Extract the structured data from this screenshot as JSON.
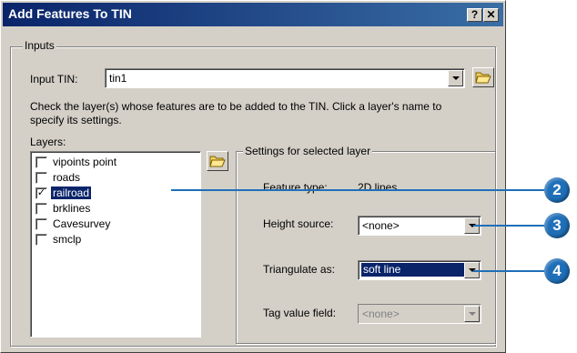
{
  "window": {
    "title": "Add Features To TIN",
    "help_button": "?",
    "close_button": "✕"
  },
  "inputs_group": {
    "legend": "Inputs",
    "input_tin_label": "Input TIN:",
    "input_tin_value": "tin1",
    "instructions": "Check the layer(s) whose features are to be added to the TIN. Click a layer's name to specify its settings.",
    "layers_label": "Layers:",
    "layers": [
      {
        "name": "vipoints point",
        "checked": false,
        "selected": false
      },
      {
        "name": "roads",
        "checked": false,
        "selected": false
      },
      {
        "name": "railroad",
        "checked": true,
        "selected": true
      },
      {
        "name": "brklines",
        "checked": false,
        "selected": false
      },
      {
        "name": "Cavesurvey",
        "checked": false,
        "selected": false
      },
      {
        "name": "smclp",
        "checked": false,
        "selected": false
      }
    ]
  },
  "settings_group": {
    "legend": "Settings for selected layer",
    "feature_type_label": "Feature type:",
    "feature_type_value": "2D lines",
    "height_source_label": "Height source:",
    "height_source_value": "<none>",
    "triangulate_label": "Triangulate as:",
    "triangulate_value": "soft line",
    "tag_value_label": "Tag value field:",
    "tag_value_value": "<none>"
  },
  "callouts": [
    "2",
    "3",
    "4"
  ],
  "colors": {
    "title_bar": "#0a246a",
    "selection": "#0a246a",
    "callout": "#1f6fb8",
    "dialog_face": "#d4d0c8"
  },
  "icons": [
    "folder-open-icon",
    "help-icon",
    "close-icon",
    "dropdown-arrow-icon",
    "checkbox-icon"
  ]
}
